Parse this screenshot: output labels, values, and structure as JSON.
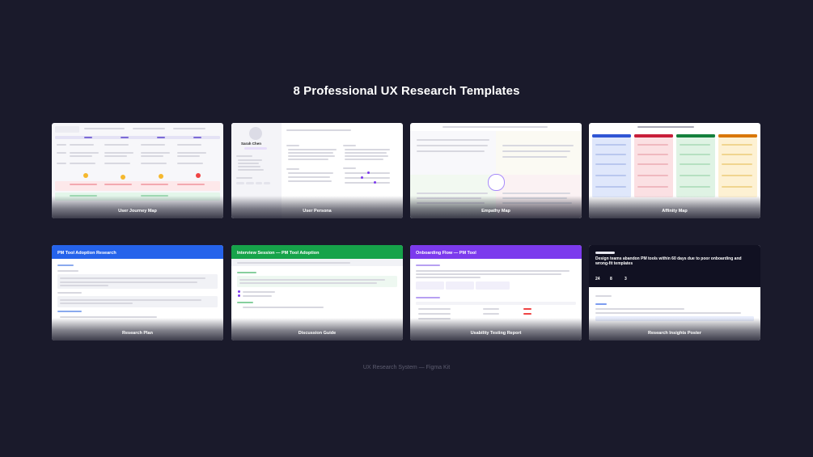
{
  "page": {
    "title": "8 Professional UX Research Templates",
    "footer": "UX Research System — Figma Kit"
  },
  "colors": {
    "background": "#1a1a2b",
    "research_plan": "#2563eb",
    "discussion_guide": "#16a34a",
    "usability_report": "#7c3aed",
    "poster": "#111122"
  },
  "templates": [
    {
      "caption": "User Journey Map"
    },
    {
      "caption": "User Persona",
      "persona_name": "Sarah Chen"
    },
    {
      "caption": "Empathy Map"
    },
    {
      "caption": "Affinity Map"
    },
    {
      "caption": "Research Plan",
      "header": "PM Tool Adoption Research"
    },
    {
      "caption": "Discussion Guide",
      "header": "Interview Session — PM Tool Adoption"
    },
    {
      "caption": "Usability Testing Report",
      "header": "Onboarding Flow — PM Tool"
    },
    {
      "caption": "Research Insights Poster",
      "headline": "Design teams abandon PM tools within 60 days due to poor onboarding and wrong-fit templates",
      "stats": [
        "24",
        "8",
        "3"
      ]
    }
  ]
}
